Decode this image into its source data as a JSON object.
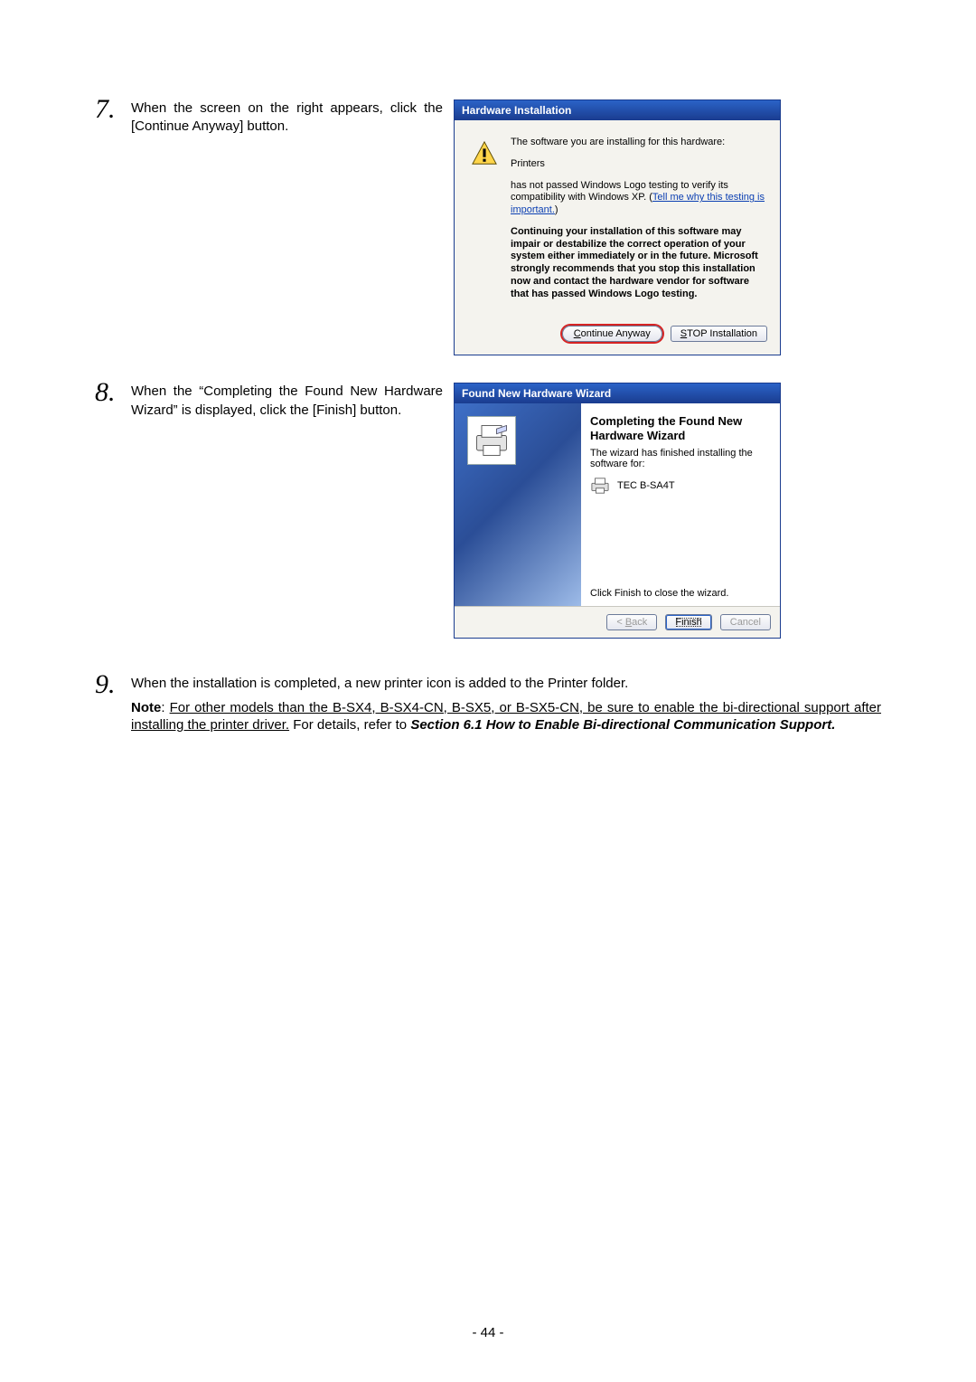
{
  "steps": {
    "seven": {
      "num": "7.",
      "text": "When the screen on the right appears, click the [Continue Anyway] button."
    },
    "eight": {
      "num": "8.",
      "text": "When the “Completing the Found New Hardware Wizard” is displayed, click the [Finish] button."
    },
    "nine": {
      "num": "9.",
      "text": "When the installation is completed, a new printer icon is added to the Printer folder."
    }
  },
  "note": {
    "label": "Note",
    "underlined": "For other models than the B-SX4, B-SX4-CN, B-SX5, or B-SX5-CN, be sure to enable the bi-directional support after installing the printer driver.",
    "mid": " For details, refer to ",
    "bold_italic": "Section 6.1 How to Enable Bi-directional Communication Support."
  },
  "dlg1": {
    "title": "Hardware Installation",
    "line1": "The software you are installing for this hardware:",
    "line2": "Printers",
    "line3a": "has not passed Windows Logo testing to verify its compatibility with Windows XP. (",
    "tell_link": "Tell me why this testing is important.",
    "line3b": ")",
    "strong": "Continuing your installation of this software may impair or destabilize the correct operation of your system either immediately or in the future. Microsoft strongly recommends that you stop this installation now and contact the hardware vendor for software that has passed Windows Logo testing.",
    "btn_continue_u": "C",
    "btn_continue_rest": "ontinue Anyway",
    "btn_stop_u": "S",
    "btn_stop_rest": "TOP Installation"
  },
  "dlg2": {
    "title": "Found New Hardware Wizard",
    "heading": "Completing the Found New Hardware Wizard",
    "sub": "The wizard has finished installing the software for:",
    "device": "TEC B-SA4T",
    "close": "Click Finish to close the wizard.",
    "btn_back_lt": "< ",
    "btn_back_u": "B",
    "btn_back_rest": "ack",
    "btn_finish": "Finish",
    "btn_cancel": "Cancel"
  },
  "page_number": "- 44 -"
}
